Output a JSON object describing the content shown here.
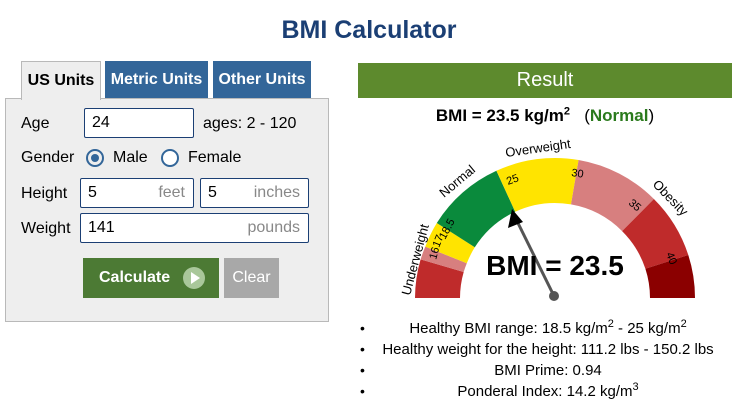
{
  "title": "BMI Calculator",
  "tabs": [
    {
      "label": "US Units",
      "active": true
    },
    {
      "label": "Metric Units",
      "active": false
    },
    {
      "label": "Other Units",
      "active": false
    }
  ],
  "form": {
    "age_label": "Age",
    "age_value": "24",
    "age_hint": "ages: 2 - 120",
    "gender_label": "Gender",
    "gender_options": [
      "Male",
      "Female"
    ],
    "gender_selected": "Male",
    "height_label": "Height",
    "height_feet": "5",
    "height_feet_unit": "feet",
    "height_inches": "5",
    "height_inches_unit": "inches",
    "weight_label": "Weight",
    "weight_value": "141",
    "weight_unit": "pounds",
    "calculate_label": "Calculate",
    "clear_label": "Clear"
  },
  "result": {
    "header": "Result",
    "bmi_text": "BMI = 23.5 kg/m",
    "bmi_exp": "2",
    "category": "Normal",
    "gauge": {
      "bmi_value": 23.5,
      "center_text": "BMI = 23.5",
      "segments": [
        {
          "label": "Underweight",
          "color": "#bf2b2b"
        },
        {
          "label": "Normal",
          "color": "#0a8a3c"
        },
        {
          "label": "Overweight",
          "color": "#ffe400"
        },
        {
          "label": "Obesity",
          "color": "#8b0000"
        }
      ],
      "ticks": [
        "16",
        "17",
        "18.5",
        "25",
        "30",
        "35",
        "40"
      ]
    },
    "facts": [
      {
        "text": "Healthy BMI range: 18.5 kg/m",
        "sup1": "2",
        "mid": " - 25 kg/m",
        "sup2": "2"
      },
      {
        "text": "Healthy weight for the height: 111.2 lbs - 150.2 lbs"
      },
      {
        "text": "BMI Prime: 0.94"
      },
      {
        "text": "Ponderal Index: 14.2 kg/m",
        "sup1": "3"
      }
    ]
  },
  "colors": {
    "title": "#1b3f74",
    "tab_inactive": "#336699",
    "calculate": "#4c7a34",
    "result_header": "#5d8a2d",
    "normal": "#2a7a1c"
  }
}
